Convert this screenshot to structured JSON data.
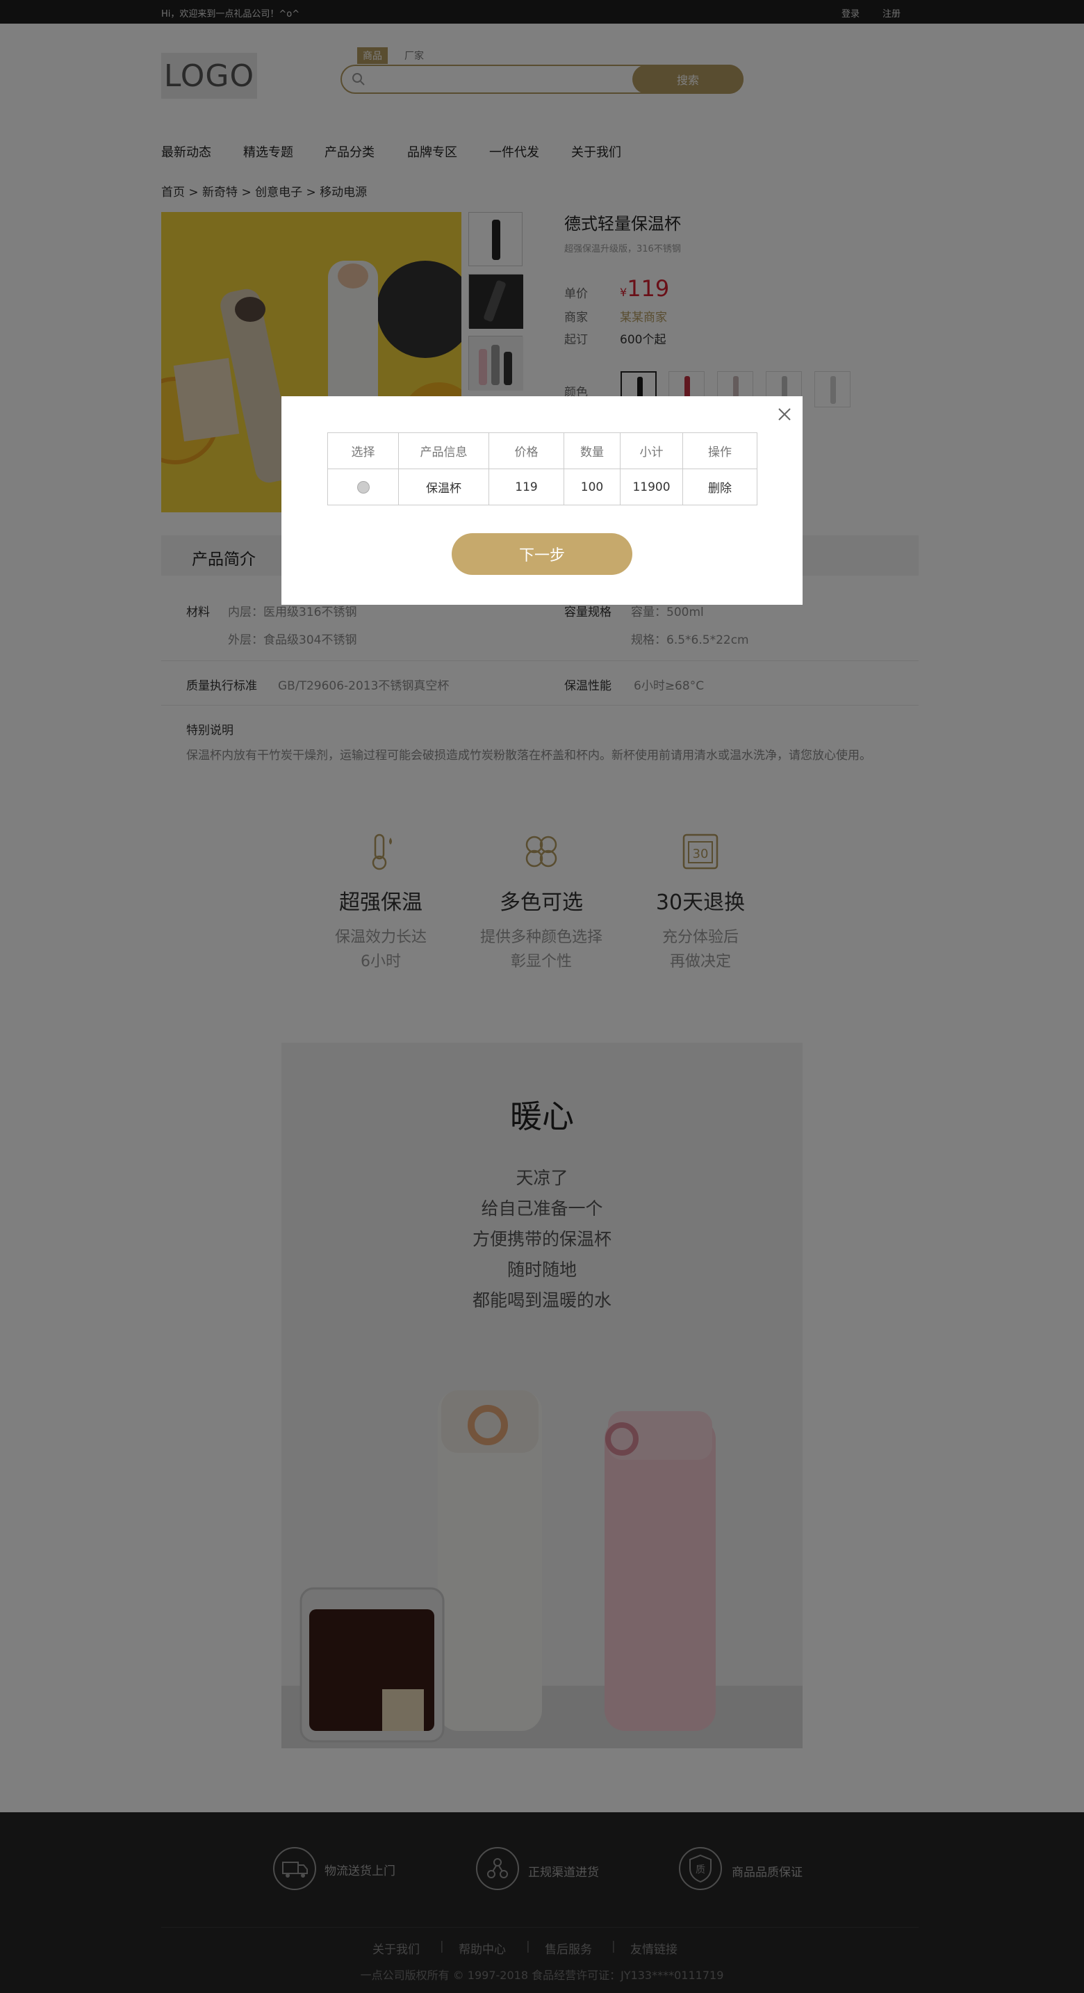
{
  "topbar": {
    "greeting": "Hi，欢迎来到一点礼品公司！^o^",
    "login": "登录",
    "register": "注册"
  },
  "header": {
    "logo_text": "LOGO",
    "search_tabs": [
      "商品",
      "厂家"
    ],
    "search_placeholder": "",
    "search_button": "搜索"
  },
  "nav": [
    "最新动态",
    "精选专题",
    "产品分类",
    "品牌专区",
    "一件代发",
    "关于我们"
  ],
  "breadcrumb": "首页 > 新奇特 > 创意电子 > 移动电源",
  "product": {
    "title": "德式轻量保温杯",
    "subtitle": "超强保温升级版，316不锈钢",
    "price_label": "单价",
    "currency": "¥",
    "price": "119",
    "merchant_label": "商家",
    "merchant": "某某商家",
    "moq_label": "起订",
    "moq": "600个起",
    "color_label": "颜色",
    "colors": [
      "#1a1a1a",
      "#c03040",
      "#c9b8b8",
      "#bfbfbf",
      "#d0d0d0"
    ]
  },
  "intro": {
    "heading": "产品简介",
    "material_k": "材料",
    "material_v1": "内层：医用级316不锈钢",
    "material_v2": "外层：食品级304不锈钢",
    "capacity_k": "容量规格",
    "capacity_v1": "容量：500ml",
    "capacity_v2": "规格：6.5*6.5*22cm",
    "standard_k": "质量执行标准",
    "standard_v": "GB/T29606-2013不锈钢真空杯",
    "keep_k": "保温性能",
    "keep_v": "6小时≥68°C",
    "note_k": "特别说明",
    "note_v": "保温杯内放有干竹炭干燥剂，运输过程可能会破损造成竹炭粉散落在杯盖和杯内。新杯使用前请用清水或温水洗净，请您放心使用。"
  },
  "features": [
    {
      "icon": "thermometer-icon",
      "title": "超强保温",
      "desc1": "保温效力长达",
      "desc2": "6小时"
    },
    {
      "icon": "four-leaf-icon",
      "title": "多色可选",
      "desc1": "提供多种颜色选择",
      "desc2": "彰显个性"
    },
    {
      "icon": "calendar-30-icon",
      "title": "30天退换",
      "desc1": "充分体验后",
      "desc2": "再做决定"
    }
  ],
  "warm": {
    "title": "暖心",
    "lines": [
      "天凉了",
      "给自己准备一个",
      "方便携带的保温杯",
      "随时随地",
      "都能喝到温暖的水"
    ]
  },
  "footer": {
    "services": [
      "物流送货上门",
      "正规渠道进货",
      "商品品质保证"
    ],
    "links": [
      "关于我们",
      "帮助中心",
      "售后服务",
      "友情链接"
    ],
    "copyright": "一点公司版权所有 © 1997-2018   食品经营许可证：JY133****0111719"
  },
  "modal": {
    "columns": [
      "选择",
      "产品信息",
      "价格",
      "数量",
      "小计",
      "操作"
    ],
    "rows": [
      {
        "name": "保温杯",
        "price": "119",
        "qty": "100",
        "subtotal": "11900",
        "action": "删除"
      }
    ],
    "next_button": "下一步"
  }
}
